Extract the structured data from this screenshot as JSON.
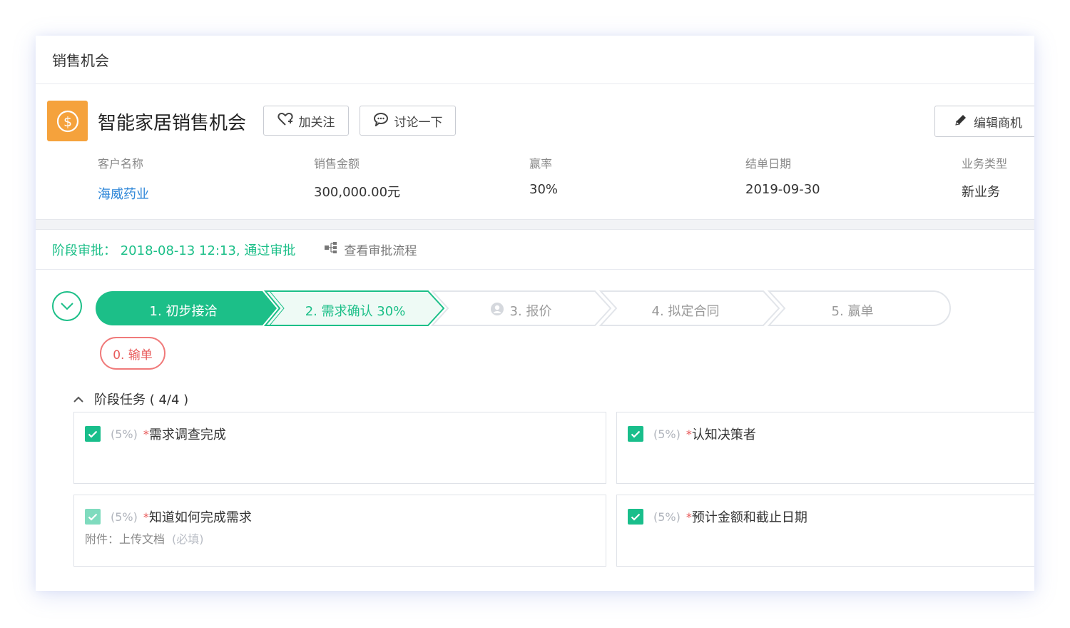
{
  "page": {
    "title": "销售机会"
  },
  "opportunity": {
    "icon": "dollar-coin-icon",
    "title": "智能家居销售机会",
    "follow_label": "加关注",
    "discuss_label": "讨论一下",
    "edit_label": "编辑商机"
  },
  "fields": [
    {
      "label": "客户名称",
      "value": "海威药业"
    },
    {
      "label": "销售金额",
      "value": "300,000.00元"
    },
    {
      "label": "赢率",
      "value": "30%"
    },
    {
      "label": "结单日期",
      "value": "2019-09-30"
    },
    {
      "label": "业务类型",
      "value": "新业务"
    }
  ],
  "approval": {
    "text": "阶段审批：  2018-08-13 12:13, 通过审批",
    "view_label": "查看审批流程"
  },
  "stages": [
    {
      "label": "1. 初步接洽",
      "state": "done"
    },
    {
      "label": "2. 需求确认 30%",
      "state": "current"
    },
    {
      "label": "3. 报价",
      "state": "pending"
    },
    {
      "label": "4. 拟定合同",
      "state": "pending"
    },
    {
      "label": "5. 赢单",
      "state": "pending"
    }
  ],
  "lost_stage": {
    "label": "0. 输单"
  },
  "tasks_section": {
    "title": "阶段任务 ( 4/4 )"
  },
  "tasks": [
    {
      "pct": "(5%)",
      "required": "*",
      "name": "需求调查完成",
      "checked": true
    },
    {
      "pct": "(5%)",
      "required": "*",
      "name": "认知决策者",
      "checked": true
    },
    {
      "pct": "(5%)",
      "required": "*",
      "name": "知道如何完成需求",
      "checked": true,
      "attachment_label": "附件：上传文档",
      "attachment_note": "(必填)"
    },
    {
      "pct": "(5%)",
      "required": "*",
      "name": "预计金额和截止日期",
      "checked": true
    }
  ],
  "colors": {
    "accent": "#1cbf88",
    "link": "#2d86d8",
    "danger": "#e85b5b",
    "logo": "#f5a23c"
  }
}
